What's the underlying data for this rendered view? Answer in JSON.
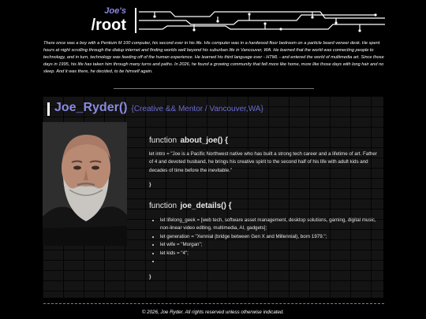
{
  "header": {
    "brand_top": "Joe's",
    "brand_main": "/root"
  },
  "intro": "There once was a boy with a Pentium M 100 computer, his second ever in his life. His computer was in a hardwood floor bedroom on a particle board veneer desk. He spent hours at night scrolling through the dialup internet and finding worlds well beyond his suburban life in Vancouver, WA. He learned that the world was connecting people to technology, and in turn, technology was feeding off of the human experience. He learned his third language ever - HTML - and entered the world of multimedia art. Since those days in 1995, his life has taken him through many turns and paths. In 2026, he found a growing community that felt more like home, more like those days with long hair and no sleep. And it was there, he decided, to be himself again.",
  "main": {
    "title_name": "Joe_Ryder()",
    "title_sub": "{Creative && Mentor / Vancouver,WA}",
    "photo_icon": "portrait-photo",
    "about": {
      "keyword": "function",
      "name": "about_joe() {",
      "text": "let intro = \"Joe is a Pacific Northwest native who has built a strong tech career and a lifetime of art. Father of 4 and devoted husband, he brings his creative spirit to the second half of his life with adult kids and decades of time before the inevitable.\"",
      "close": "}"
    },
    "details": {
      "keyword": "function",
      "name": "joe_details() {",
      "items": [
        "let lifelong_geek = [web tech, software asset management, desktop solutions, gaming, digital music, non-linear video editing, multimedia, AI, gadgets];",
        "let generation = \"Xennial (bridge between Gen X and Millennial), born 1979.\";",
        "let wife = \"Morgan\";",
        "let kids = \"4\";",
        ""
      ],
      "close": "}"
    }
  },
  "footer": "© 2026, Joe Ryder. All rights reserved unless otherwise indicated.",
  "colors": {
    "accent": "#8a8ae0",
    "accent_dark": "#6b6bd0",
    "background": "#000000",
    "panel": "#141414"
  }
}
